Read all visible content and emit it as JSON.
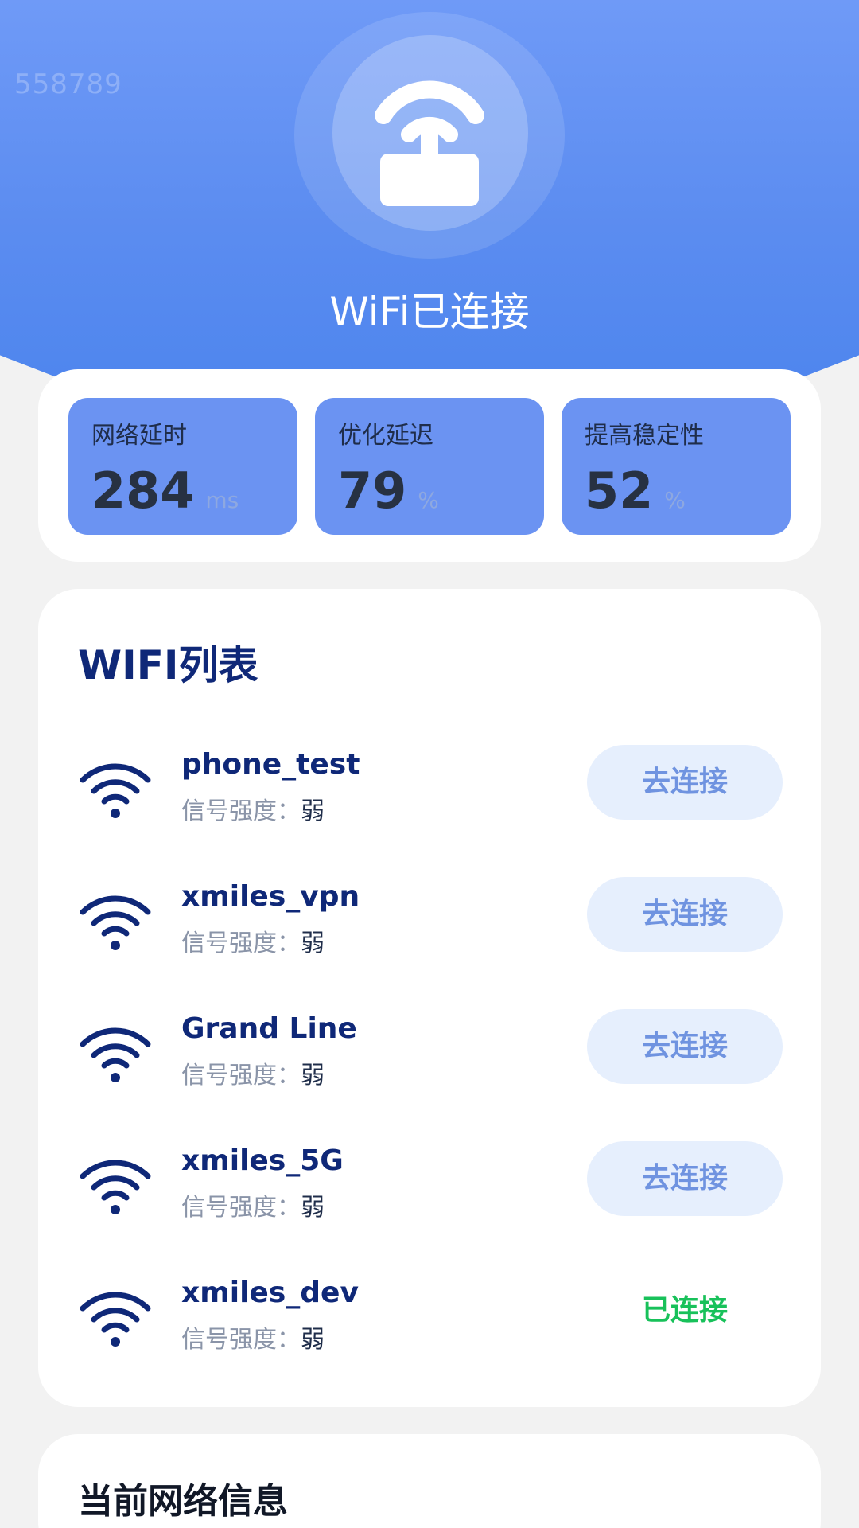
{
  "header": {
    "watermark": "558789",
    "title": "WiFi已连接",
    "icon": "router-icon"
  },
  "stats": [
    {
      "label": "网络延时",
      "value": "284",
      "unit": "ms"
    },
    {
      "label": "优化延迟",
      "value": "79",
      "unit": "%"
    },
    {
      "label": "提高稳定性",
      "value": "52",
      "unit": "%"
    }
  ],
  "wifi_list": {
    "title": "WIFI列表",
    "signal_label": "信号强度：",
    "items": [
      {
        "name": "phone_test",
        "signal": "弱",
        "action": "去连接",
        "status": "disconnected"
      },
      {
        "name": "xmiles_vpn",
        "signal": "弱",
        "action": "去连接",
        "status": "disconnected"
      },
      {
        "name": "Grand Line",
        "signal": "弱",
        "action": "去连接",
        "status": "disconnected"
      },
      {
        "name": "xmiles_5G",
        "signal": "弱",
        "action": "去连接",
        "status": "disconnected"
      },
      {
        "name": "xmiles_dev",
        "signal": "弱",
        "action": "已连接",
        "status": "connected"
      }
    ]
  },
  "current_network": {
    "title": "当前网络信息"
  },
  "colors": {
    "accent": "#5b8cf0",
    "title_navy": "#0f2878",
    "connected_green": "#18c15a",
    "button_bg": "#e6effd"
  }
}
